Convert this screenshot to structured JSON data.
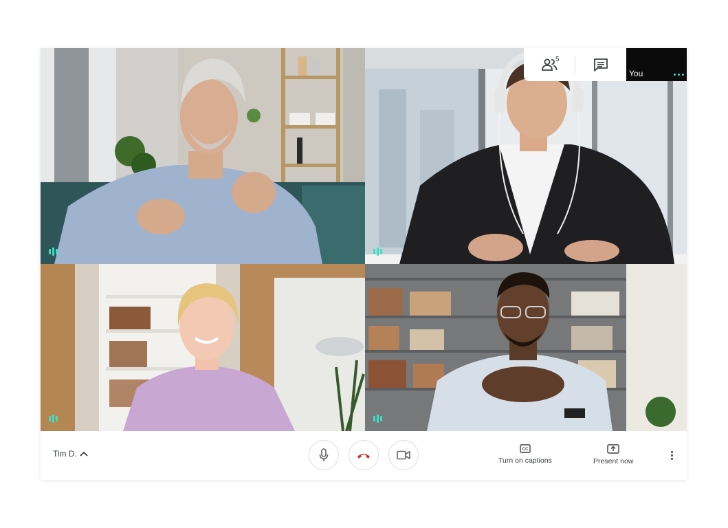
{
  "top_bar": {
    "participants_count": "5",
    "participants_icon": "people-icon",
    "chat_icon": "chat-icon",
    "self_view_label": "You"
  },
  "participants": [
    {
      "tile": "top-left",
      "speaking_indicator": "audio-level-icon"
    },
    {
      "tile": "top-right",
      "speaking_indicator": "audio-level-icon"
    },
    {
      "tile": "bottom-left",
      "speaking_indicator": "audio-level-icon"
    },
    {
      "tile": "bottom-right",
      "speaking_indicator": "audio-level-icon"
    }
  ],
  "bottom_bar": {
    "meeting_name": "Tim D.",
    "captions_label": "Turn on captions",
    "present_label": "Present now"
  },
  "colors": {
    "accent_teal": "#3ddcc4",
    "hangup_red": "#d93025",
    "icon_gray": "#5f6368"
  }
}
